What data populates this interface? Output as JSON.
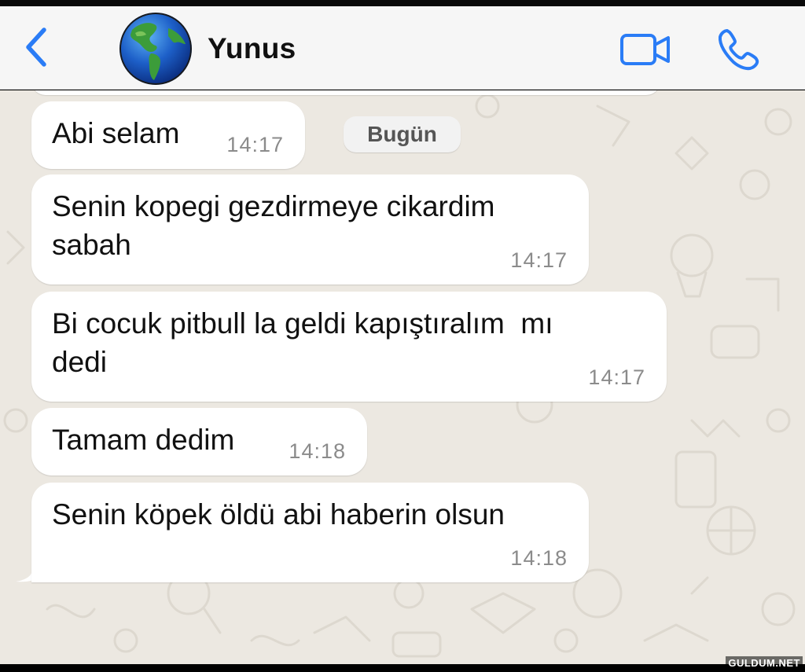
{
  "header": {
    "contact_name": "Yunus",
    "back_icon": "chevron-left-icon",
    "avatar_icon": "globe-emoji",
    "video_icon": "video-camera-icon",
    "call_icon": "phone-icon",
    "accent_color": "#2a7cf6",
    "background_color": "#f6f6f6"
  },
  "chat": {
    "date_chip": "Bugün",
    "wallpaper_color": "#ece8e1",
    "bubble_color": "#ffffff",
    "messages": [
      {
        "text": "Abi selam",
        "time": "14:17"
      },
      {
        "text": "Senin kopegi gezdirmeye cikardim\nsabah",
        "time": "14:17"
      },
      {
        "text": "Bi cocuk pitbull la geldi kapıştıralım  mı\ndedi",
        "time": "14:17"
      },
      {
        "text": "Tamam dedim",
        "time": "14:18"
      },
      {
        "text": "Senin köpek öldü abi haberin olsun",
        "time": "14:18"
      }
    ]
  },
  "watermark": "GULDUM.NET"
}
